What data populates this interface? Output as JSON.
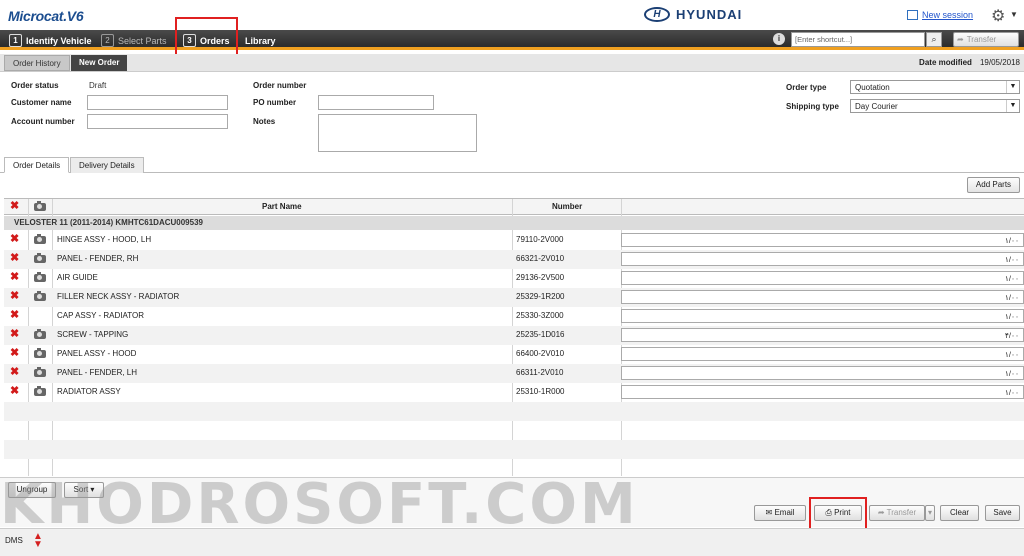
{
  "app": {
    "logo": "Microcat",
    "version": ".V6",
    "brand_mark": "H",
    "brand": "HYUNDAI",
    "new_session": "New session"
  },
  "steps": [
    {
      "num": "1",
      "label": "Identify Vehicle"
    },
    {
      "num": "2",
      "label": "Select Parts"
    },
    {
      "num": "3",
      "label": "Orders"
    },
    {
      "label": "Library"
    }
  ],
  "shortcut": {
    "placeholder": "[Enter shortcut...]",
    "transfer": "Transfer"
  },
  "tabs": {
    "history": "Order History",
    "new_order": "New Order"
  },
  "date_modified": {
    "label": "Date modified",
    "value": "19/05/2018"
  },
  "form": {
    "order_status_label": "Order status",
    "order_status_value": "Draft",
    "customer_name_label": "Customer name",
    "account_number_label": "Account number",
    "order_number_label": "Order number",
    "po_number_label": "PO number",
    "notes_label": "Notes",
    "order_type_label": "Order type",
    "order_type_value": "Quotation",
    "shipping_type_label": "Shipping type",
    "shipping_type_value": "Day Courier"
  },
  "subtabs": {
    "order_details": "Order Details",
    "delivery_details": "Delivery Details"
  },
  "add_parts": "Add Parts",
  "grid": {
    "columns": {
      "part_name": "Part Name",
      "number": "Number"
    },
    "group": "VELOSTER 11 (2011-2014) KMHTC61DACU009539",
    "rows": [
      {
        "name": "HINGE ASSY - HOOD, LH",
        "number": "79110-2V000",
        "qty": "۱/۰۰"
      },
      {
        "name": "PANEL - FENDER, RH",
        "number": "66321-2V010",
        "qty": "۱/۰۰"
      },
      {
        "name": "AIR GUIDE",
        "number": "29136-2V500",
        "qty": "۱/۰۰"
      },
      {
        "name": "FILLER NECK ASSY - RADIATOR",
        "number": "25329-1R200",
        "qty": "۱/۰۰"
      },
      {
        "name": "CAP ASSY - RADIATOR",
        "number": "25330-3Z000",
        "qty": "۱/۰۰"
      },
      {
        "name": "SCREW - TAPPING",
        "number": "25235-1D016",
        "qty": "۴/۰۰"
      },
      {
        "name": "PANEL ASSY - HOOD",
        "number": "66400-2V010",
        "qty": "۱/۰۰"
      },
      {
        "name": "PANEL - FENDER, LH",
        "number": "66311-2V010",
        "qty": "۱/۰۰"
      },
      {
        "name": "RADIATOR ASSY",
        "number": "25310-1R000",
        "qty": "۱/۰۰"
      }
    ]
  },
  "footer": {
    "ungroup": "Ungroup",
    "sort": "Sort ▾",
    "email": "Email",
    "print": "Print",
    "transfer": "Transfer",
    "clear": "Clear",
    "save": "Save"
  },
  "watermark": "KHODROSOFT.COM",
  "status": {
    "dms": "DMS"
  },
  "colors": {
    "accent": "#f0a020",
    "highlight": "#e02020",
    "delete": "#d21a1a",
    "brand": "#1b3f74"
  }
}
